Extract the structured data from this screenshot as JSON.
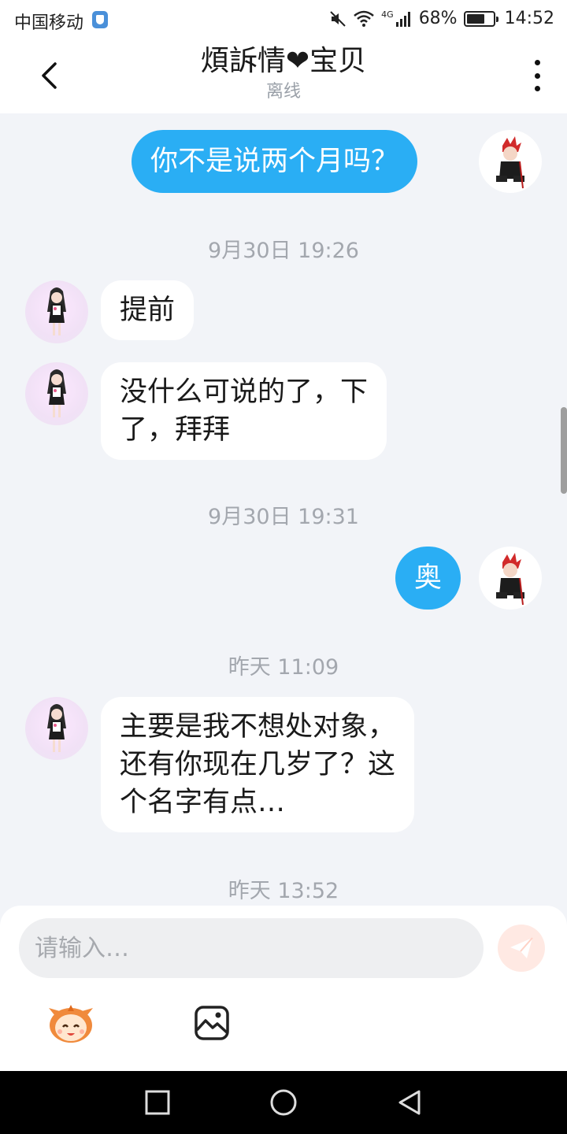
{
  "status_bar": {
    "carrier": "中国移动",
    "network": "4G",
    "battery": "68%",
    "battery_level": 0.68,
    "time": "14:52"
  },
  "header": {
    "title": "煩訴情❤宝贝",
    "subtitle": "离线"
  },
  "messages": [
    {
      "side": "out",
      "text": "你不是说两个月吗？"
    },
    {
      "timestamp": "9月30日 19:26"
    },
    {
      "side": "in",
      "text": "提前"
    },
    {
      "side": "in",
      "lines": [
        "没什么可说的了，下",
        "了，拜拜"
      ]
    },
    {
      "timestamp": "9月30日 19:31"
    },
    {
      "side": "out",
      "text": "奥"
    },
    {
      "timestamp": "昨天 11:09"
    },
    {
      "side": "in",
      "lines": [
        "主要是我不想处对象，",
        "还有你现在几岁了？这",
        "个名字有点…"
      ]
    },
    {
      "timestamp": "昨天 13:52"
    }
  ],
  "input": {
    "placeholder": "请输入…"
  },
  "icons": {
    "back": "chevron-left-icon",
    "more": "more-vertical-icon",
    "send": "send-icon",
    "emoji": "emoji-face-icon",
    "image": "image-icon",
    "nav_recent": "square-icon",
    "nav_home": "circle-icon",
    "nav_back": "triangle-back-icon"
  },
  "colors": {
    "outgoing_bubble": "#2aaef4",
    "incoming_bubble": "#ffffff",
    "chat_background": "#f2f4f8",
    "send_button": "#ffe9e3",
    "heart": "#e8262f"
  }
}
